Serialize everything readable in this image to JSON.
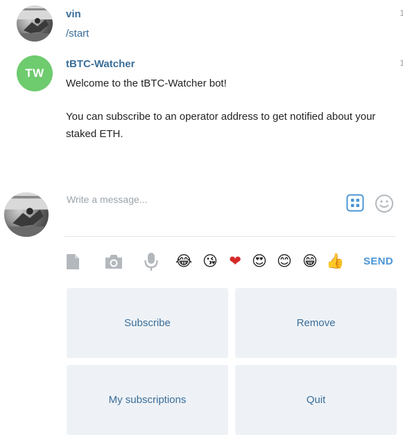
{
  "messages": [
    {
      "author": "vin",
      "time": "1",
      "text": "/start"
    },
    {
      "author": "tBTC-Watcher",
      "avatar_initials": "TW",
      "time": "1",
      "text_line1": "Welcome to the tBTC-Watcher bot!",
      "text_line2": "You can subscribe to an operator address to get notified about your staked ETH."
    }
  ],
  "composer": {
    "placeholder": "Write a message...",
    "send_label": "SEND",
    "attach_icons": [
      "file-icon",
      "camera-icon",
      "microphone-icon"
    ],
    "emojis": [
      "😂",
      "😘",
      "❤",
      "😍",
      "😊",
      "😁",
      "👍"
    ]
  },
  "keyboard": {
    "buttons": [
      "Subscribe",
      "Remove",
      "My subscriptions",
      "Quit"
    ]
  },
  "colors": {
    "accent": "#3a6d99",
    "send": "#4a95d6",
    "bot_avatar": "#6ecb6e",
    "key_bg": "#eef2f6"
  }
}
